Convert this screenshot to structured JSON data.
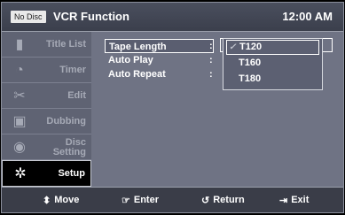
{
  "header": {
    "badge": "No Disc",
    "title": "VCR Function",
    "time": "12:00 AM"
  },
  "sidebar": {
    "items": [
      {
        "label": "Title List",
        "icon": "film-icon",
        "glyph": "▮"
      },
      {
        "label": "Timer",
        "icon": "clock-icon",
        "glyph": "◔"
      },
      {
        "label": "Edit",
        "icon": "scissors-icon",
        "glyph": "✂"
      },
      {
        "label": "Dubbing",
        "icon": "dubbing-icon",
        "glyph": "▣"
      },
      {
        "label": "Disc\nSetting",
        "icon": "disc-icon",
        "glyph": "◉"
      },
      {
        "label": "Setup",
        "icon": "gear-icon",
        "glyph": "✲"
      }
    ],
    "active_index": 5
  },
  "settings": [
    {
      "label": "Tape Length",
      "colon": ":"
    },
    {
      "label": "Auto Play",
      "colon": ":"
    },
    {
      "label": "Auto Repeat",
      "colon": ":"
    }
  ],
  "dropdown": {
    "options": [
      "T120",
      "T160",
      "T180"
    ],
    "checked": "T120",
    "check_glyph": "✓"
  },
  "footer": {
    "move": {
      "glyph": "⬍",
      "label": "Move"
    },
    "enter": {
      "glyph": "☞",
      "label": "Enter"
    },
    "return": {
      "glyph": "↺",
      "label": "Return"
    },
    "exit": {
      "glyph": "⇥",
      "label": "Exit"
    }
  }
}
